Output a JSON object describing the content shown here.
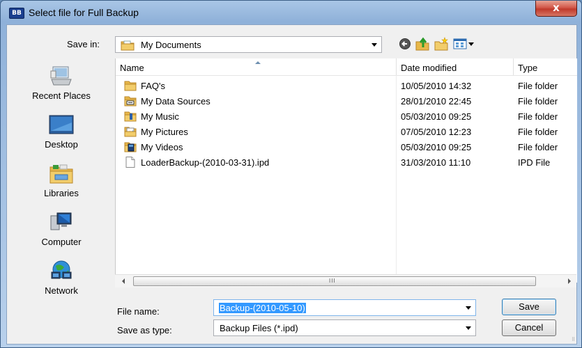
{
  "window": {
    "title": "Select file for Full Backup",
    "app_icon_text": "BB",
    "close_glyph": "x"
  },
  "save_in": {
    "label": "Save in:",
    "value": "My Documents"
  },
  "places": [
    {
      "name": "recent-places",
      "label": "Recent Places"
    },
    {
      "name": "desktop",
      "label": "Desktop"
    },
    {
      "name": "libraries",
      "label": "Libraries"
    },
    {
      "name": "computer",
      "label": "Computer"
    },
    {
      "name": "network",
      "label": "Network"
    }
  ],
  "columns": {
    "name": "Name",
    "date": "Date modified",
    "type": "Type"
  },
  "files": [
    {
      "name": "FAQ's",
      "date": "10/05/2010 14:32",
      "type": "File folder",
      "icon": "folder-icon"
    },
    {
      "name": "My Data Sources",
      "date": "28/01/2010 22:45",
      "type": "File folder",
      "icon": "data-sources-folder-icon"
    },
    {
      "name": "My Music",
      "date": "05/03/2010 09:25",
      "type": "File folder",
      "icon": "music-folder-icon"
    },
    {
      "name": "My Pictures",
      "date": "07/05/2010 12:23",
      "type": "File folder",
      "icon": "pictures-folder-icon"
    },
    {
      "name": "My Videos",
      "date": "05/03/2010 09:25",
      "type": "File folder",
      "icon": "videos-folder-icon"
    },
    {
      "name": "LoaderBackup-(2010-03-31).ipd",
      "date": "31/03/2010 11:10",
      "type": "IPD File",
      "icon": "file-icon"
    }
  ],
  "scrollbar": {
    "grip": "III"
  },
  "file_name": {
    "label": "File name:",
    "value": "Backup-(2010-05-10)"
  },
  "save_as_type": {
    "label": "Save as type:",
    "value": "Backup Files (*.ipd)"
  },
  "buttons": {
    "save": "Save",
    "cancel": "Cancel"
  },
  "colors": {
    "selection": "#3399ff",
    "folder": "#e8b84a",
    "title_close": "#c0392b"
  }
}
